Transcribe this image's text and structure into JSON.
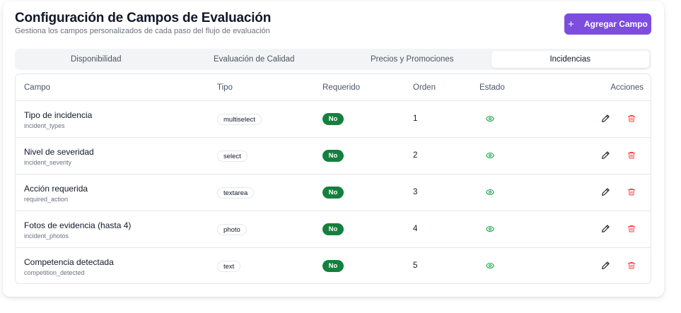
{
  "header": {
    "title": "Configuración de Campos de Evaluación",
    "subtitle": "Gestiona los campos personalizados de cada paso del flujo de evaluación",
    "add_button_label": "Agregar Campo"
  },
  "tabs": [
    {
      "label": "Disponibilidad",
      "active": false
    },
    {
      "label": "Evaluación de Calidad",
      "active": false
    },
    {
      "label": "Precios y Promociones",
      "active": false
    },
    {
      "label": "Incidencias",
      "active": true
    }
  ],
  "table": {
    "columns": [
      "Campo",
      "Tipo",
      "Requerido",
      "Orden",
      "Estado",
      "Acciones"
    ],
    "rows": [
      {
        "label": "Tipo de incidencia",
        "key": "incident_types",
        "type": "multiselect",
        "required": "No",
        "order": "1",
        "state_icon": "eye-icon"
      },
      {
        "label": "Nivel de severidad",
        "key": "incident_severity",
        "type": "select",
        "required": "No",
        "order": "2",
        "state_icon": "eye-icon"
      },
      {
        "label": "Acción requerida",
        "key": "required_action",
        "type": "textarea",
        "required": "No",
        "order": "3",
        "state_icon": "eye-icon"
      },
      {
        "label": "Fotos de evidencia (hasta 4)",
        "key": "incident_photos",
        "type": "photo",
        "required": "No",
        "order": "4",
        "state_icon": "eye-icon"
      },
      {
        "label": "Competencia detectada",
        "key": "competition_detected",
        "type": "text",
        "required": "No",
        "order": "5",
        "state_icon": "eye-icon"
      }
    ]
  },
  "colors": {
    "accent": "#7c4ddf",
    "required_badge": "#15803d",
    "visible_icon": "#16a34a",
    "delete_icon": "#ef4444"
  }
}
